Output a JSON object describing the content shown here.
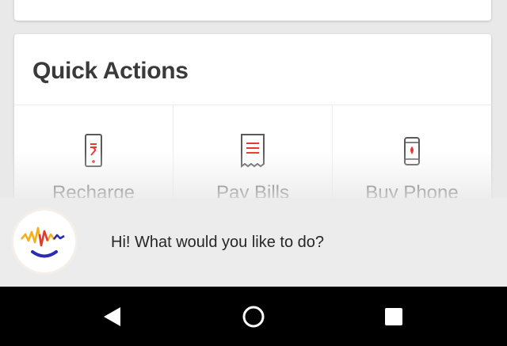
{
  "quick_actions": {
    "title": "Quick Actions",
    "items": [
      {
        "label": "Recharge",
        "icon": "phone-recharge-icon"
      },
      {
        "label": "Pay Bills",
        "icon": "bill-receipt-icon"
      },
      {
        "label": "Buy Phone",
        "icon": "mobile-phone-icon"
      }
    ]
  },
  "assistant": {
    "avatar_icon": "assistant-face-icon",
    "message": "Hi! What would you like to do?"
  },
  "nav_bar": {
    "back_icon": "back-triangle-icon",
    "home_icon": "home-circle-icon",
    "recents_icon": "recents-square-icon"
  },
  "colors": {
    "accent": "#e53935",
    "assistant_blue": "#2b2bb8",
    "nav_background": "#000000",
    "banner_background": "#ececec"
  }
}
